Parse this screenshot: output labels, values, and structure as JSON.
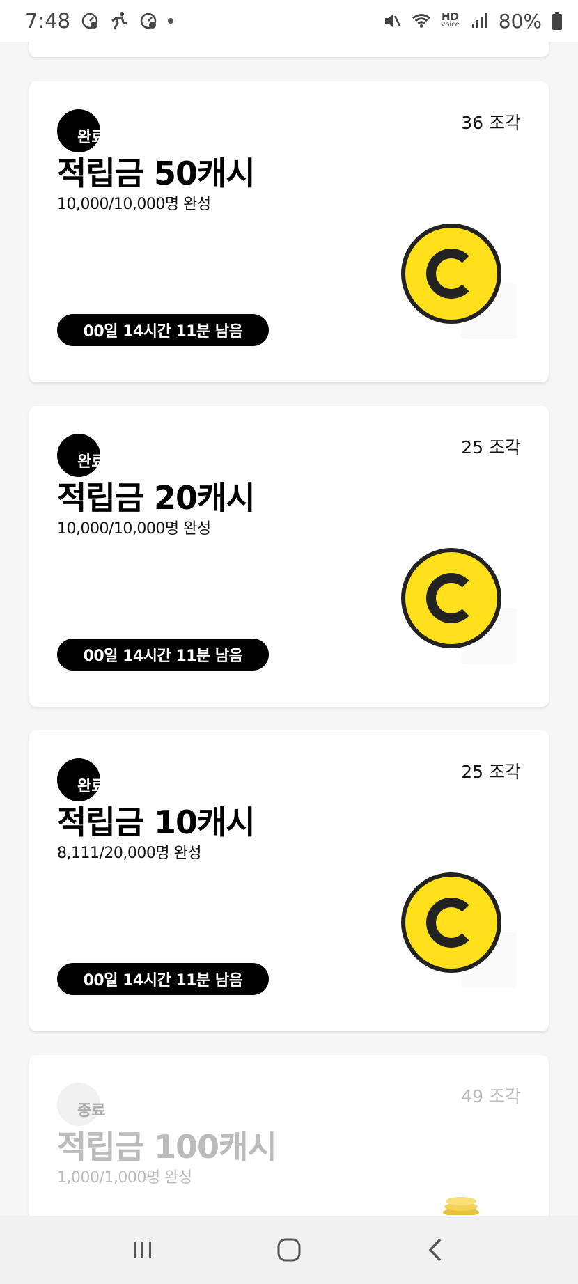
{
  "status_bar": {
    "time": "7:48",
    "hd_voice": "HD",
    "hd_voice_sub": "voice",
    "battery": "80%"
  },
  "cards": [
    {
      "status": "완료",
      "pieces": "36 조각",
      "title": "적립금 50캐시",
      "progress": "10,000/10,000명 완성",
      "timer": "00일 14시간 11분 남음",
      "icon": "yellow-c-coin-icon"
    },
    {
      "status": "완료",
      "pieces": "25 조각",
      "title": "적립금 20캐시",
      "progress": "10,000/10,000명 완성",
      "timer": "00일 14시간 11분 남음",
      "icon": "yellow-c-coin-icon"
    },
    {
      "status": "완료",
      "pieces": "25 조각",
      "title": "적립금 10캐시",
      "progress": "8,111/20,000명 완성",
      "timer": "00일 14시간 11분 남음",
      "icon": "yellow-c-coin-icon"
    },
    {
      "status": "종료",
      "pieces": "49 조각",
      "title": "적립금 100캐시",
      "progress": "1,000/1,000명 완성",
      "icon": "gold-coins-icon"
    }
  ],
  "nav_bar": {
    "recents": "recents-icon",
    "home": "home-icon",
    "back": "back-icon"
  },
  "colors": {
    "coin_yellow": "#ffe01a",
    "badge_black": "#000000",
    "ended_gray": "#bbbbbb"
  }
}
